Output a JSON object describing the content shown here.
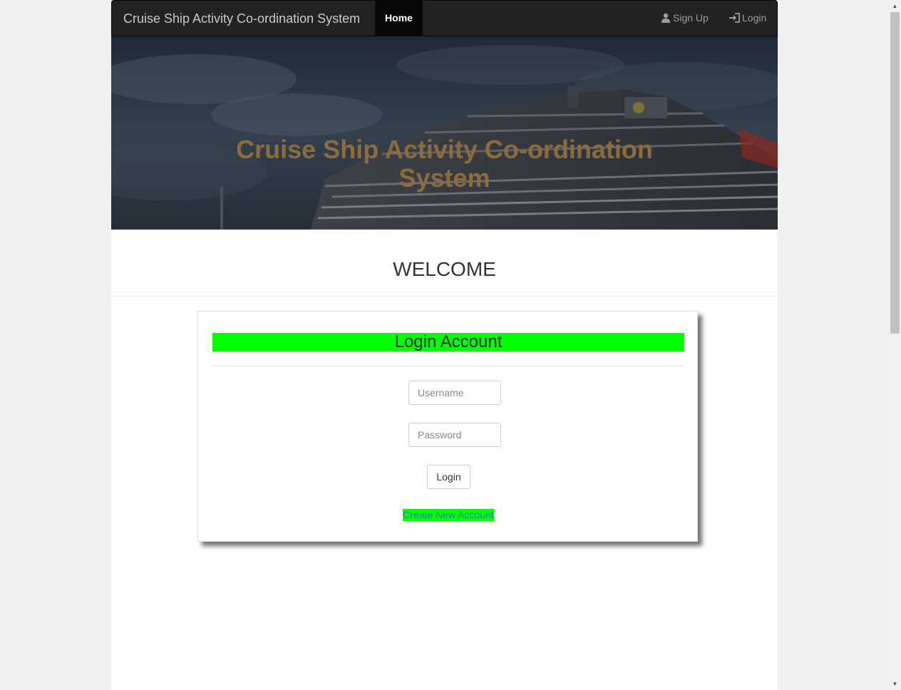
{
  "navbar": {
    "brand": "Cruise Ship Activity Co-ordination System",
    "home_label": "Home",
    "signup_label": "Sign Up",
    "login_label": "Login",
    "signup_icon": "user-icon",
    "login_icon": "login-icon"
  },
  "hero": {
    "title_line1": "Cruise Ship Activity Co-ordination",
    "title_line2": "System"
  },
  "main": {
    "welcome": "WELCOME"
  },
  "login_card": {
    "title": "Login Account",
    "username_placeholder": "Username",
    "password_placeholder": "Password",
    "login_button": "Login",
    "create_account_link": "Create New Account"
  },
  "colors": {
    "navbar_bg": "#222222",
    "home_active_bg": "#080808",
    "hero_title": "#8b6c3d",
    "highlight_green": "#00ff00",
    "link_blue": "#337ab7"
  }
}
